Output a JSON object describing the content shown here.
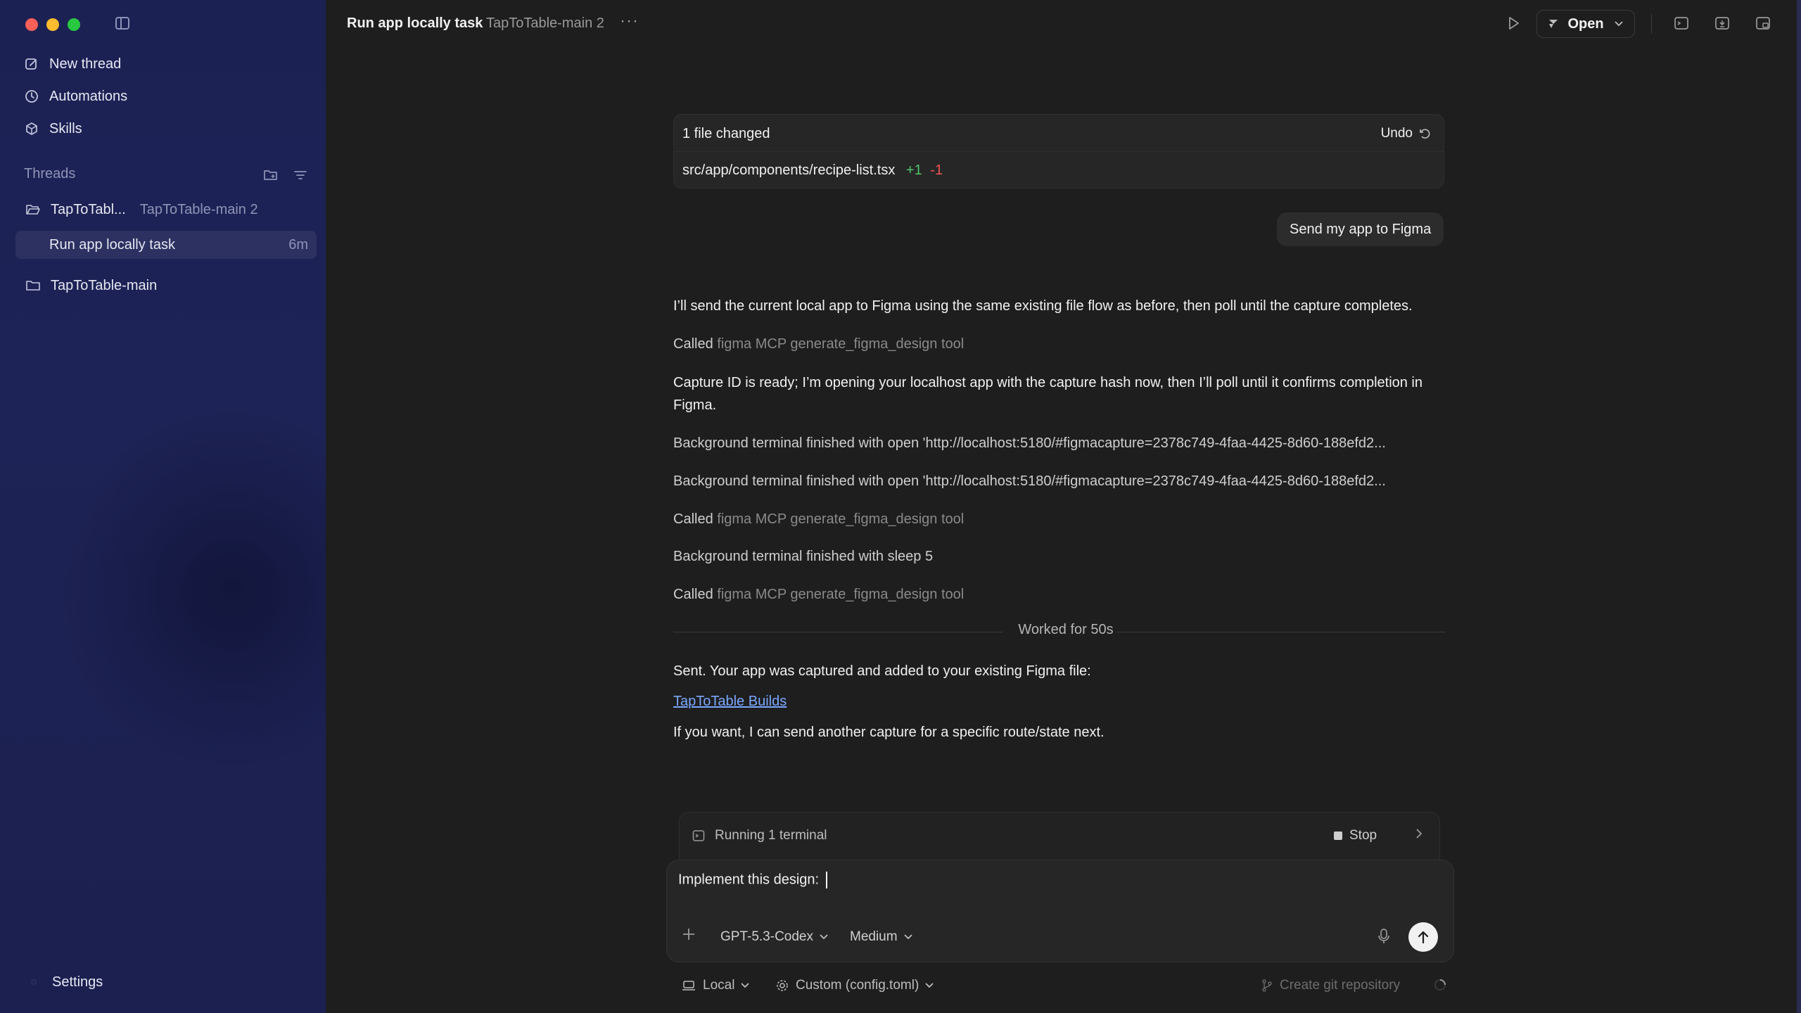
{
  "sidebar": {
    "nav": [
      {
        "label": "New thread",
        "icon": "edit-icon"
      },
      {
        "label": "Automations",
        "icon": "clock-icon"
      },
      {
        "label": "Skills",
        "icon": "cube-icon"
      }
    ],
    "threads_header": "Threads",
    "threads": [
      {
        "name": "TapToTabl...",
        "meta": "TapToTable-main 2"
      },
      {
        "name": "Run app locally task",
        "meta": "6m"
      },
      {
        "name": "TapToTable-main",
        "meta": ""
      }
    ],
    "settings_label": "Settings"
  },
  "topbar": {
    "title": "Run app locally task",
    "subtitle": "TapToTable-main 2",
    "more": "···",
    "open_label": "Open"
  },
  "file_card": {
    "title": "1 file changed",
    "undo_label": "Undo",
    "path": "src/app/components/recipe-list.tsx",
    "added": "+1",
    "removed": "-1"
  },
  "conversation": {
    "user_message": "Send my app to Figma",
    "msg1": "I’ll send the current local app to Figma using the same existing file flow as before, then poll until the capture completes.",
    "called_prefix": "Called",
    "called_tool": "figma MCP generate_figma_design tool",
    "msg2": "Capture ID is ready; I’m opening your localhost app with the capture hash now, then I’ll poll until it confirms completion in Figma.",
    "bg1": "Background terminal finished with open 'http://localhost:5180/#figmacapture=2378c749-4faa-4425-8d60-188efd2...",
    "bg2": "Background terminal finished with open 'http://localhost:5180/#figmacapture=2378c749-4faa-4425-8d60-188efd2...",
    "bg3": "Background terminal finished with sleep 5",
    "worked": "Worked for 50s",
    "sent": "Sent. Your app was captured and added to your existing Figma file:",
    "link": "TapToTable Builds",
    "closing": "If you want, I can send another capture for a specific route/state next."
  },
  "terminal": {
    "label": "Running 1 terminal",
    "stop_label": "Stop"
  },
  "composer": {
    "value": "Implement this design: ",
    "model": "GPT-5.3-Codex",
    "effort": "Medium"
  },
  "footer": {
    "local": "Local",
    "config": "Custom (config.toml)",
    "git": "Create git repository"
  },
  "colors": {
    "sidebar_bg": "#1c2154",
    "main_bg": "#1e1e1e",
    "added": "#4ec36a",
    "removed": "#ef5350",
    "link": "#7aa7ff"
  }
}
